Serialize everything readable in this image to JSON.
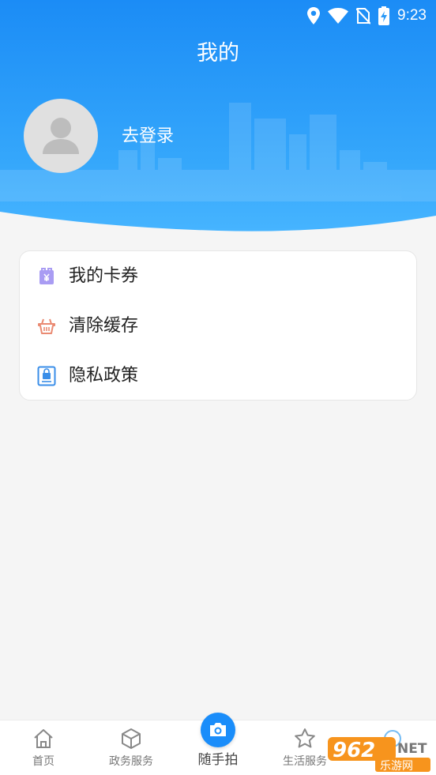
{
  "status": {
    "time": "9:23"
  },
  "page": {
    "title": "我的"
  },
  "profile": {
    "login_label": "去登录"
  },
  "menu": {
    "items": [
      {
        "label": "我的卡券",
        "icon": "coupon-icon"
      },
      {
        "label": "清除缓存",
        "icon": "basket-icon"
      },
      {
        "label": "隐私政策",
        "icon": "privacy-lock-icon"
      }
    ]
  },
  "tabbar": {
    "tabs": [
      {
        "label": "首页",
        "icon": "home-icon"
      },
      {
        "label": "政务服务",
        "icon": "cube-icon"
      },
      {
        "label": "随手拍",
        "icon": "camera-icon"
      },
      {
        "label": "生活服务",
        "icon": "star-icon"
      }
    ]
  },
  "watermark": {
    "brand_top": "962",
    "brand_net": "NET",
    "brand_bottom": "乐游网"
  },
  "colors": {
    "primary_blue": "#1a8dfa",
    "header_top": "#1e8ff7",
    "header_bottom": "#49b6ff",
    "background": "#f5f5f5"
  }
}
